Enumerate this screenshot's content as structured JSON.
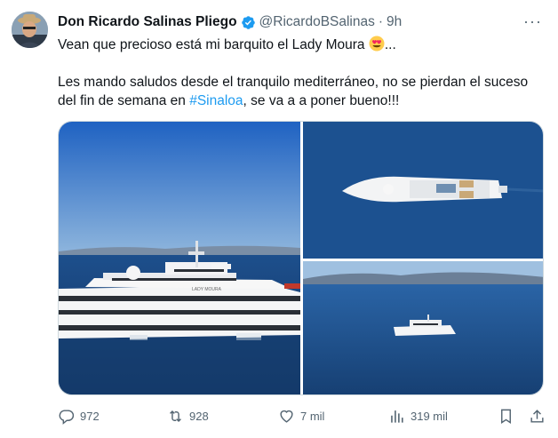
{
  "author": {
    "name": "Don Ricardo Salinas Pliego",
    "handle": "@RicardoBSalinas",
    "separator": "·",
    "time": "9h"
  },
  "more_label": "···",
  "tweet": {
    "line1": "Vean que precioso está mi barquito el Lady Moura ",
    "line1_suffix": "...",
    "para2_before": "Les mando saludos desde el tranquilo mediterráneo, no se pierdan el suceso del fin de semana en ",
    "hashtag": "#Sinaloa",
    "para2_after": ", se va a a poner bueno!!!"
  },
  "yacht_name_plate": "LADY MOURA",
  "actions": {
    "replies": "972",
    "reposts": "928",
    "likes": "7 mil",
    "views": "319 mil"
  },
  "colors": {
    "accent": "#1d9bf0",
    "muted": "#536471",
    "sea": "#1d4f8c",
    "sky": "#8fb6dd"
  },
  "icons": [
    "verified-badge-icon",
    "more-icon",
    "smiling-face-with-heart-eyes-emoji",
    "reply-icon",
    "repost-icon",
    "like-icon",
    "views-icon",
    "bookmark-icon",
    "share-icon"
  ]
}
